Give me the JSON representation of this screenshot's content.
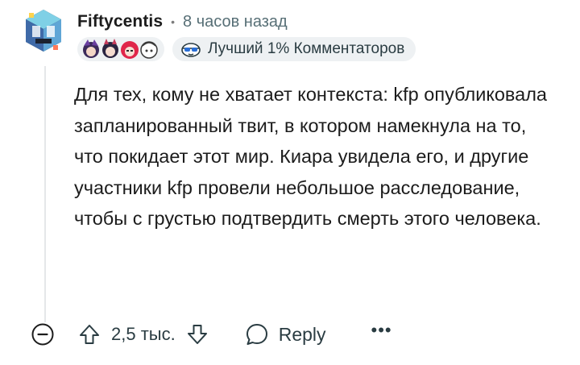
{
  "comment": {
    "author": "Fiftycentis",
    "separator": "•",
    "time_ago": "8 часов назад",
    "flair": {
      "emojis": [
        "avatar-emoji-1",
        "avatar-emoji-2",
        "avatar-emoji-3",
        "avatar-emoji-4"
      ],
      "badge_icon": "sunglasses-face-icon",
      "badge_label": "Лучший 1% Комментаторов"
    },
    "body": "Для тех, кому не хватает контекста: kfp опубликовала запланированный твит, в котором намекнула на то, что покидает этот мир. Киара увидела его, и другие участники kfp провели небольшое расследование, чтобы с грустью подтвердить смерть этого человека."
  },
  "actions": {
    "collapse_icon": "minus-circle-icon",
    "upvote_icon": "arrow-up-outline-icon",
    "score": "2,5 тыс.",
    "downvote_icon": "arrow-down-outline-icon",
    "reply_icon": "speech-bubble-icon",
    "reply_label": "Reply",
    "more_label": "•••"
  },
  "colors": {
    "text": "#1c1c1c",
    "meta": "#576f76",
    "pill_bg": "#eef1f3",
    "thread_line": "#e5e7e9"
  }
}
